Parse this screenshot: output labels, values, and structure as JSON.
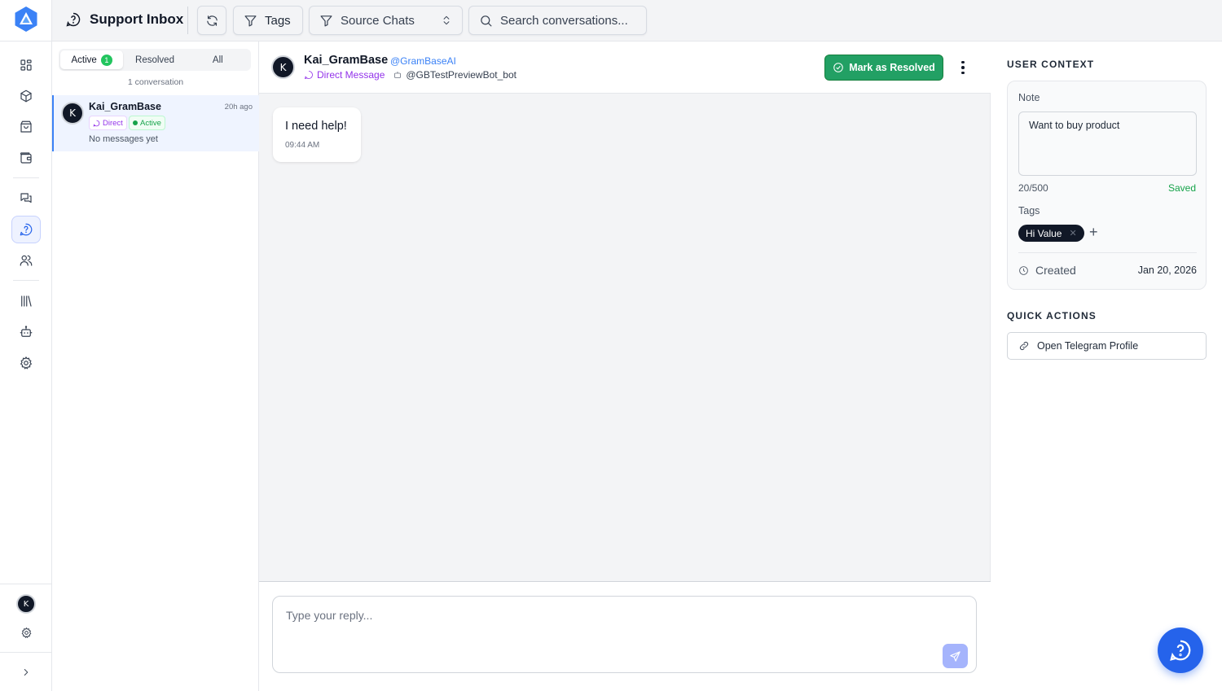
{
  "header": {
    "title": "Support Inbox",
    "tags_label": "Tags",
    "source_chats_label": "Source Chats",
    "search_placeholder": "Search conversations..."
  },
  "list": {
    "tabs": [
      {
        "label": "Active",
        "count": "1"
      },
      {
        "label": "Resolved"
      },
      {
        "label": "All"
      }
    ],
    "count_text": "1 conversation",
    "conversations": [
      {
        "avatar": "K",
        "name": "Kai_GramBase",
        "time": "20h ago",
        "type_badge": "Direct",
        "status_badge": "Active",
        "preview": "No messages yet"
      }
    ]
  },
  "chat": {
    "avatar": "K",
    "name": "Kai_GramBase",
    "username": "@GramBaseAI",
    "type": "Direct Message",
    "bot": "@GBTestPreviewBot_bot",
    "resolve_label": "Mark as Resolved",
    "messages": [
      {
        "text": "I need help!",
        "time": "09:44 AM"
      }
    ],
    "reply_placeholder": "Type your reply..."
  },
  "context": {
    "title": "USER CONTEXT",
    "note_label": "Note",
    "note_value": "Want to buy product",
    "note_counter": "20/500",
    "note_status": "Saved",
    "tags_label": "Tags",
    "tags": [
      "Hi Value"
    ],
    "created_label": "Created",
    "created_value": "Jan 20, 2026"
  },
  "quick_actions": {
    "title": "QUICK ACTIONS",
    "open_profile_label": "Open Telegram Profile"
  },
  "sidebar": {
    "user_avatar": "K",
    "icons": [
      "dashboard-icon",
      "box-icon",
      "shopping-bag-icon",
      "wallet-icon",
      "messages-icon",
      "support-icon",
      "users-icon",
      "library-icon",
      "bot-icon",
      "settings-icon"
    ]
  },
  "colors": {
    "accent": "#2563eb",
    "success": "#22a064",
    "direct": "#9333ea"
  }
}
